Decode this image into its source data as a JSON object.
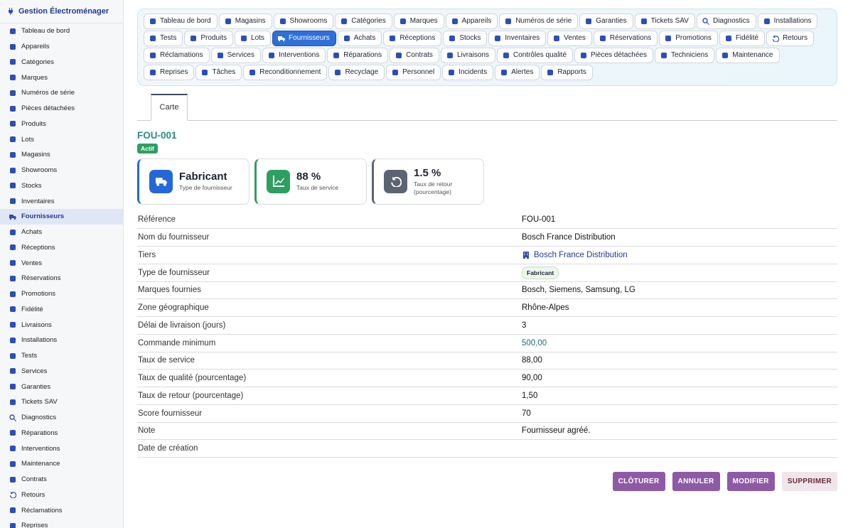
{
  "app": {
    "title": "Gestion Électroménager"
  },
  "sidebar": {
    "items": [
      {
        "label": "Tableau de bord",
        "icon": "dashboard-icon"
      },
      {
        "label": "Appareils",
        "icon": "plug-icon"
      },
      {
        "label": "Catégories",
        "icon": "sitemap-icon"
      },
      {
        "label": "Marques",
        "icon": "gear-icon"
      },
      {
        "label": "Numéros de série",
        "icon": "barcode-icon"
      },
      {
        "label": "Pièces détachées",
        "icon": "cog-icon"
      },
      {
        "label": "Produits",
        "icon": "box-icon"
      },
      {
        "label": "Lots",
        "icon": "cubes-icon"
      },
      {
        "label": "Magasins",
        "icon": "store-icon"
      },
      {
        "label": "Showrooms",
        "icon": "grid-icon"
      },
      {
        "label": "Stocks",
        "icon": "warehouse-icon"
      },
      {
        "label": "Inventaires",
        "icon": "clipboard-icon"
      },
      {
        "label": "Fournisseurs",
        "icon": "truck-icon",
        "active": true
      },
      {
        "label": "Achats",
        "icon": "cart-icon"
      },
      {
        "label": "Réceptions",
        "icon": "dolly-icon"
      },
      {
        "label": "Ventes",
        "icon": "cash-register-icon"
      },
      {
        "label": "Réservations",
        "icon": "bookmark-icon"
      },
      {
        "label": "Promotions",
        "icon": "tags-icon"
      },
      {
        "label": "Fidélité",
        "icon": "award-icon"
      },
      {
        "label": "Livraisons",
        "icon": "shipping-icon"
      },
      {
        "label": "Installations",
        "icon": "wrench-icon"
      },
      {
        "label": "Tests",
        "icon": "bolt-icon"
      },
      {
        "label": "Services",
        "icon": "bell-concierge-icon"
      },
      {
        "label": "Garanties",
        "icon": "shield-icon"
      },
      {
        "label": "Tickets SAV",
        "icon": "lifebuoy-icon"
      },
      {
        "label": "Diagnostics",
        "icon": "search-icon"
      },
      {
        "label": "Réparations",
        "icon": "tools-icon"
      },
      {
        "label": "Interventions",
        "icon": "helmet-icon"
      },
      {
        "label": "Maintenance",
        "icon": "hammer-icon"
      },
      {
        "label": "Contrats",
        "icon": "file-contract-icon"
      },
      {
        "label": "Retours",
        "icon": "undo-icon"
      },
      {
        "label": "Réclamations",
        "icon": "comment-icon"
      },
      {
        "label": "Reprises",
        "icon": "exchange-icon"
      }
    ]
  },
  "tabs": [
    {
      "label": "Tableau de bord",
      "icon": "dashboard-icon"
    },
    {
      "label": "Magasins",
      "icon": "store-icon"
    },
    {
      "label": "Showrooms",
      "icon": "grid-icon"
    },
    {
      "label": "Catégories",
      "icon": "sitemap-icon"
    },
    {
      "label": "Marques",
      "icon": "gear-icon"
    },
    {
      "label": "Appareils",
      "icon": "plug-icon"
    },
    {
      "label": "Numéros de série",
      "icon": "barcode-icon"
    },
    {
      "label": "Garanties",
      "icon": "shield-icon"
    },
    {
      "label": "Tickets SAV",
      "icon": "lifebuoy-icon"
    },
    {
      "label": "Diagnostics",
      "icon": "search-icon"
    },
    {
      "label": "Installations",
      "icon": "wrench-icon"
    },
    {
      "label": "Tests",
      "icon": "bolt-icon"
    },
    {
      "label": "Produits",
      "icon": "box-icon"
    },
    {
      "label": "Lots",
      "icon": "cubes-icon"
    },
    {
      "label": "Fournisseurs",
      "icon": "truck-icon",
      "active": true
    },
    {
      "label": "Achats",
      "icon": "cart-icon"
    },
    {
      "label": "Réceptions",
      "icon": "dolly-icon"
    },
    {
      "label": "Stocks",
      "icon": "warehouse-icon"
    },
    {
      "label": "Inventaires",
      "icon": "clipboard-icon"
    },
    {
      "label": "Ventes",
      "icon": "cash-register-icon"
    },
    {
      "label": "Réservations",
      "icon": "bookmark-icon"
    },
    {
      "label": "Promotions",
      "icon": "tags-icon"
    },
    {
      "label": "Fidélité",
      "icon": "award-icon"
    },
    {
      "label": "Retours",
      "icon": "undo-icon"
    },
    {
      "label": "Réclamations",
      "icon": "comment-icon"
    },
    {
      "label": "Services",
      "icon": "bell-concierge-icon"
    },
    {
      "label": "Interventions",
      "icon": "helmet-icon"
    },
    {
      "label": "Réparations",
      "icon": "tools-icon"
    },
    {
      "label": "Contrats",
      "icon": "file-contract-icon"
    },
    {
      "label": "Livraisons",
      "icon": "shipping-icon"
    },
    {
      "label": "Contrôles qualité",
      "icon": "clipboard-check-icon"
    },
    {
      "label": "Pièces détachées",
      "icon": "cog-icon"
    },
    {
      "label": "Techniciens",
      "icon": "id-badge-icon"
    },
    {
      "label": "Maintenance",
      "icon": "hammer-icon"
    },
    {
      "label": "Reprises",
      "icon": "exchange-icon"
    },
    {
      "label": "Tâches",
      "icon": "list-icon"
    },
    {
      "label": "Reconditionnement",
      "icon": "redo-icon"
    },
    {
      "label": "Recyclage",
      "icon": "recycle-icon"
    },
    {
      "label": "Personnel",
      "icon": "users-icon"
    },
    {
      "label": "Incidents",
      "icon": "warning-icon"
    },
    {
      "label": "Alertes",
      "icon": "bell-icon"
    },
    {
      "label": "Rapports",
      "icon": "chart-pie-icon"
    }
  ],
  "subtab": {
    "label": "Carte"
  },
  "record": {
    "code": "FOU-001",
    "status": "Actif",
    "cards": [
      {
        "value": "Fabricant",
        "label": "Type de fournisseur",
        "icon": "truck-icon",
        "color": "#2468d8"
      },
      {
        "value": "88 %",
        "label": "Taux de service",
        "icon": "chart-line-icon",
        "color": "#2f9e62"
      },
      {
        "value": "1.5 %",
        "label": "Taux de retour (pourcentage)",
        "icon": "undo-icon",
        "color": "#5b6472"
      }
    ],
    "fields": [
      {
        "label": "Référence",
        "value": "FOU-001"
      },
      {
        "label": "Nom du fournisseur",
        "value": "Bosch France Distribution"
      },
      {
        "label": "Tiers",
        "value": "Bosch France Distribution",
        "kind": "link"
      },
      {
        "label": "Type de fournisseur",
        "value": "Fabricant",
        "kind": "pill"
      },
      {
        "label": "Marques fournies",
        "value": "Bosch, Siemens, Samsung, LG"
      },
      {
        "label": "Zone géographique",
        "value": "Rhône-Alpes"
      },
      {
        "label": "Délai de livraison (jours)",
        "value": "3"
      },
      {
        "label": "Commande minimum",
        "value": "500,00",
        "kind": "num"
      },
      {
        "label": "Taux de service",
        "value": "88,00"
      },
      {
        "label": "Taux de qualité (pourcentage)",
        "value": "90,00"
      },
      {
        "label": "Taux de retour (pourcentage)",
        "value": "1,50"
      },
      {
        "label": "Score fournisseur",
        "value": "70"
      },
      {
        "label": "Note",
        "value": "Fournisseur agréé."
      },
      {
        "label": "Date de création",
        "value": ""
      }
    ]
  },
  "actions": {
    "close": "CLÔTURER",
    "cancel": "ANNULER",
    "edit": "MODIFIER",
    "delete": "SUPPRIMER"
  }
}
